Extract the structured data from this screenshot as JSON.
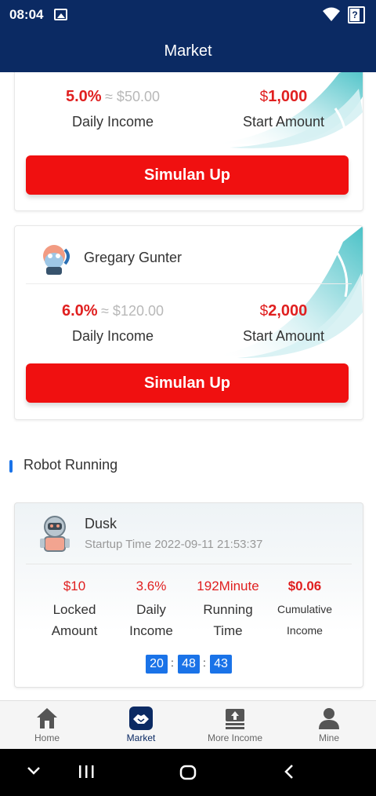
{
  "status_bar": {
    "time": "08:04",
    "battery_text": "?"
  },
  "header": {
    "title": "Market"
  },
  "plans": [
    {
      "rate": "5.0%",
      "approx": "≈ $50.00",
      "currency": "$",
      "start_amount": "1,000",
      "rate_label": "Daily Income",
      "amount_label": "Start Amount",
      "button": "Simulan Up"
    },
    {
      "owner": "Gregary Gunter",
      "rate": "6.0%",
      "approx": "≈ $120.00",
      "currency": "$",
      "start_amount": "2,000",
      "rate_label": "Daily Income",
      "amount_label": "Start Amount",
      "button": "Simulan Up"
    }
  ],
  "section": {
    "title": "Robot Running"
  },
  "robot": {
    "name": "Dusk",
    "startup": "Startup Time 2022-09-11 21:53:37",
    "stats": [
      {
        "value": "$10",
        "label1": "Locked",
        "label2": "Amount"
      },
      {
        "value": "3.6%",
        "label1": "Daily",
        "label2": "Income"
      },
      {
        "value": "192Minute",
        "label1": "Running",
        "label2": "Time"
      },
      {
        "value": "$0.06",
        "label1": "Cumulative",
        "label2": "Income"
      }
    ],
    "timer": {
      "hh": "20",
      "mm": "48",
      "ss": "43",
      "sep": ":"
    }
  },
  "nav": [
    {
      "label": "Home",
      "icon": "home-icon"
    },
    {
      "label": "Market",
      "icon": "handshake-icon",
      "active": true
    },
    {
      "label": "More Income",
      "icon": "money-stack-icon"
    },
    {
      "label": "Mine",
      "icon": "person-icon"
    }
  ],
  "colors": {
    "brand": "#0b2a63",
    "accent_red": "#f01010",
    "blue": "#1a73e8"
  }
}
